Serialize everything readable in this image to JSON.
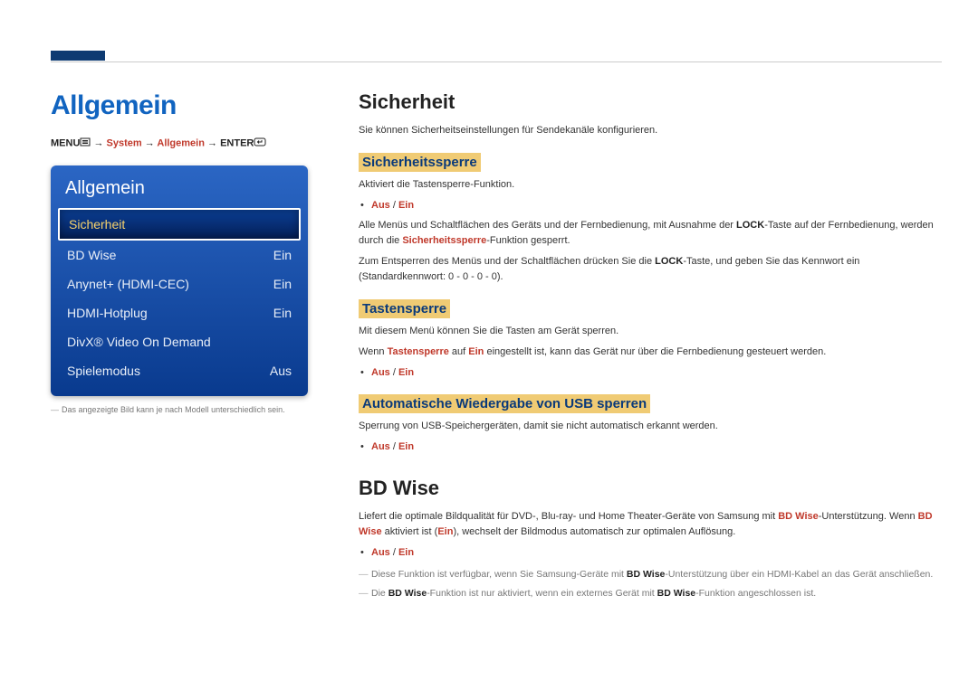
{
  "left": {
    "title": "Allgemein",
    "breadcrumb": {
      "menu": "MENU",
      "arrow": " → ",
      "system": "System",
      "allgemein": "Allgemein",
      "enter": "ENTER"
    },
    "menu": {
      "header": "Allgemein",
      "items": [
        {
          "label": "Sicherheit",
          "value": "",
          "selected": true
        },
        {
          "label": "BD Wise",
          "value": "Ein",
          "selected": false
        },
        {
          "label": "Anynet+ (HDMI-CEC)",
          "value": "Ein",
          "selected": false
        },
        {
          "label": "HDMI-Hotplug",
          "value": "Ein",
          "selected": false
        },
        {
          "label": "DivX® Video On Demand",
          "value": "",
          "selected": false
        },
        {
          "label": "Spielemodus",
          "value": "Aus",
          "selected": false
        }
      ]
    },
    "note": "Das angezeigte Bild kann je nach Modell unterschiedlich sein."
  },
  "right": {
    "sicherheit": {
      "heading": "Sicherheit",
      "intro": "Sie können Sicherheitseinstellungen für Sendekanäle konfigurieren.",
      "sperre": {
        "title": "Sicherheitssperre",
        "p1": "Aktiviert die Tastensperre-Funktion.",
        "opt_prefix": "Aus",
        "opt_sep": " / ",
        "opt_suffix": "Ein",
        "p2a": "Alle Menüs und Schaltflächen des Geräts und der Fernbedienung, mit Ausnahme der ",
        "p2b": "LOCK",
        "p2c": "-Taste auf der Fernbedienung, werden durch die ",
        "p2d": "Sicherheitssperre",
        "p2e": "-Funktion gesperrt.",
        "p3a": "Zum Entsperren des Menüs und der Schaltflächen drücken Sie die ",
        "p3b": "LOCK",
        "p3c": "-Taste, und geben Sie das Kennwort ein (Standardkennwort: 0 - 0 - 0 - 0)."
      },
      "tasten": {
        "title": "Tastensperre",
        "p1": "Mit diesem Menü können Sie die Tasten am Gerät sperren.",
        "p2a": "Wenn ",
        "p2b": "Tastensperre",
        "p2c": " auf ",
        "p2d": "Ein",
        "p2e": " eingestellt ist, kann das Gerät nur über die Fernbedienung gesteuert werden.",
        "opt_prefix": "Aus",
        "opt_sep": " / ",
        "opt_suffix": "Ein"
      },
      "usb": {
        "title": "Automatische Wiedergabe von USB sperren",
        "p1": "Sperrung von USB-Speichergeräten, damit sie nicht automatisch erkannt werden.",
        "opt_prefix": "Aus",
        "opt_sep": " / ",
        "opt_suffix": "Ein"
      }
    },
    "bdwise": {
      "heading": "BD Wise",
      "p1a": "Liefert die optimale Bildqualität für DVD-, Blu-ray- und Home Theater-Geräte von Samsung mit ",
      "p1b": "BD Wise",
      "p1c": "-Unterstützung. Wenn ",
      "p1d": "BD Wise",
      "p1e": " aktiviert ist (",
      "p1f": "Ein",
      "p1g": "), wechselt der Bildmodus automatisch zur optimalen Auflösung.",
      "opt_prefix": "Aus",
      "opt_sep": " / ",
      "opt_suffix": "Ein",
      "n1a": "Diese Funktion ist verfügbar, wenn Sie Samsung-Geräte mit ",
      "n1b": "BD Wise",
      "n1c": "-Unterstützung über ein HDMI-Kabel an das Gerät anschließen.",
      "n2a": "Die ",
      "n2b": "BD Wise",
      "n2c": "-Funktion ist nur aktiviert, wenn ein externes Gerät mit ",
      "n2d": "BD Wise",
      "n2e": "-Funktion angeschlossen ist."
    }
  }
}
